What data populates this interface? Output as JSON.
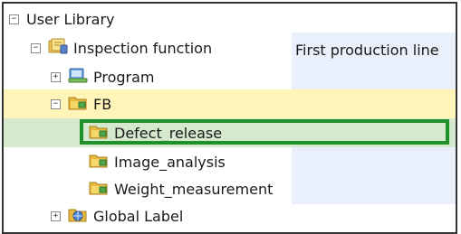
{
  "tree": {
    "root": {
      "label": "User Library",
      "expanded": true,
      "icon": "minus-toggle"
    },
    "inspection_function": {
      "label": "Inspection function",
      "detail": "First production line",
      "icon": "library-book-icon"
    },
    "program": {
      "label": "Program",
      "icon": "program-icon"
    },
    "fb": {
      "label": "FB",
      "icon": "folder-icon"
    },
    "fb_items": [
      {
        "label": "Defect_release",
        "selected": true,
        "icon": "folder-icon"
      },
      {
        "label": "Image_analysis",
        "icon": "folder-icon"
      },
      {
        "label": "Weight_measurement",
        "icon": "folder-icon"
      }
    ],
    "global_label": {
      "label": "Global Label",
      "icon": "global-label-icon"
    }
  },
  "colors": {
    "panel_border": "#333333",
    "detail_column": "#e9f0fb",
    "fb_row_highlight": "#fff5b8",
    "selected_row": "#d5e9cf",
    "selection_outline": "#1f8f2a"
  }
}
